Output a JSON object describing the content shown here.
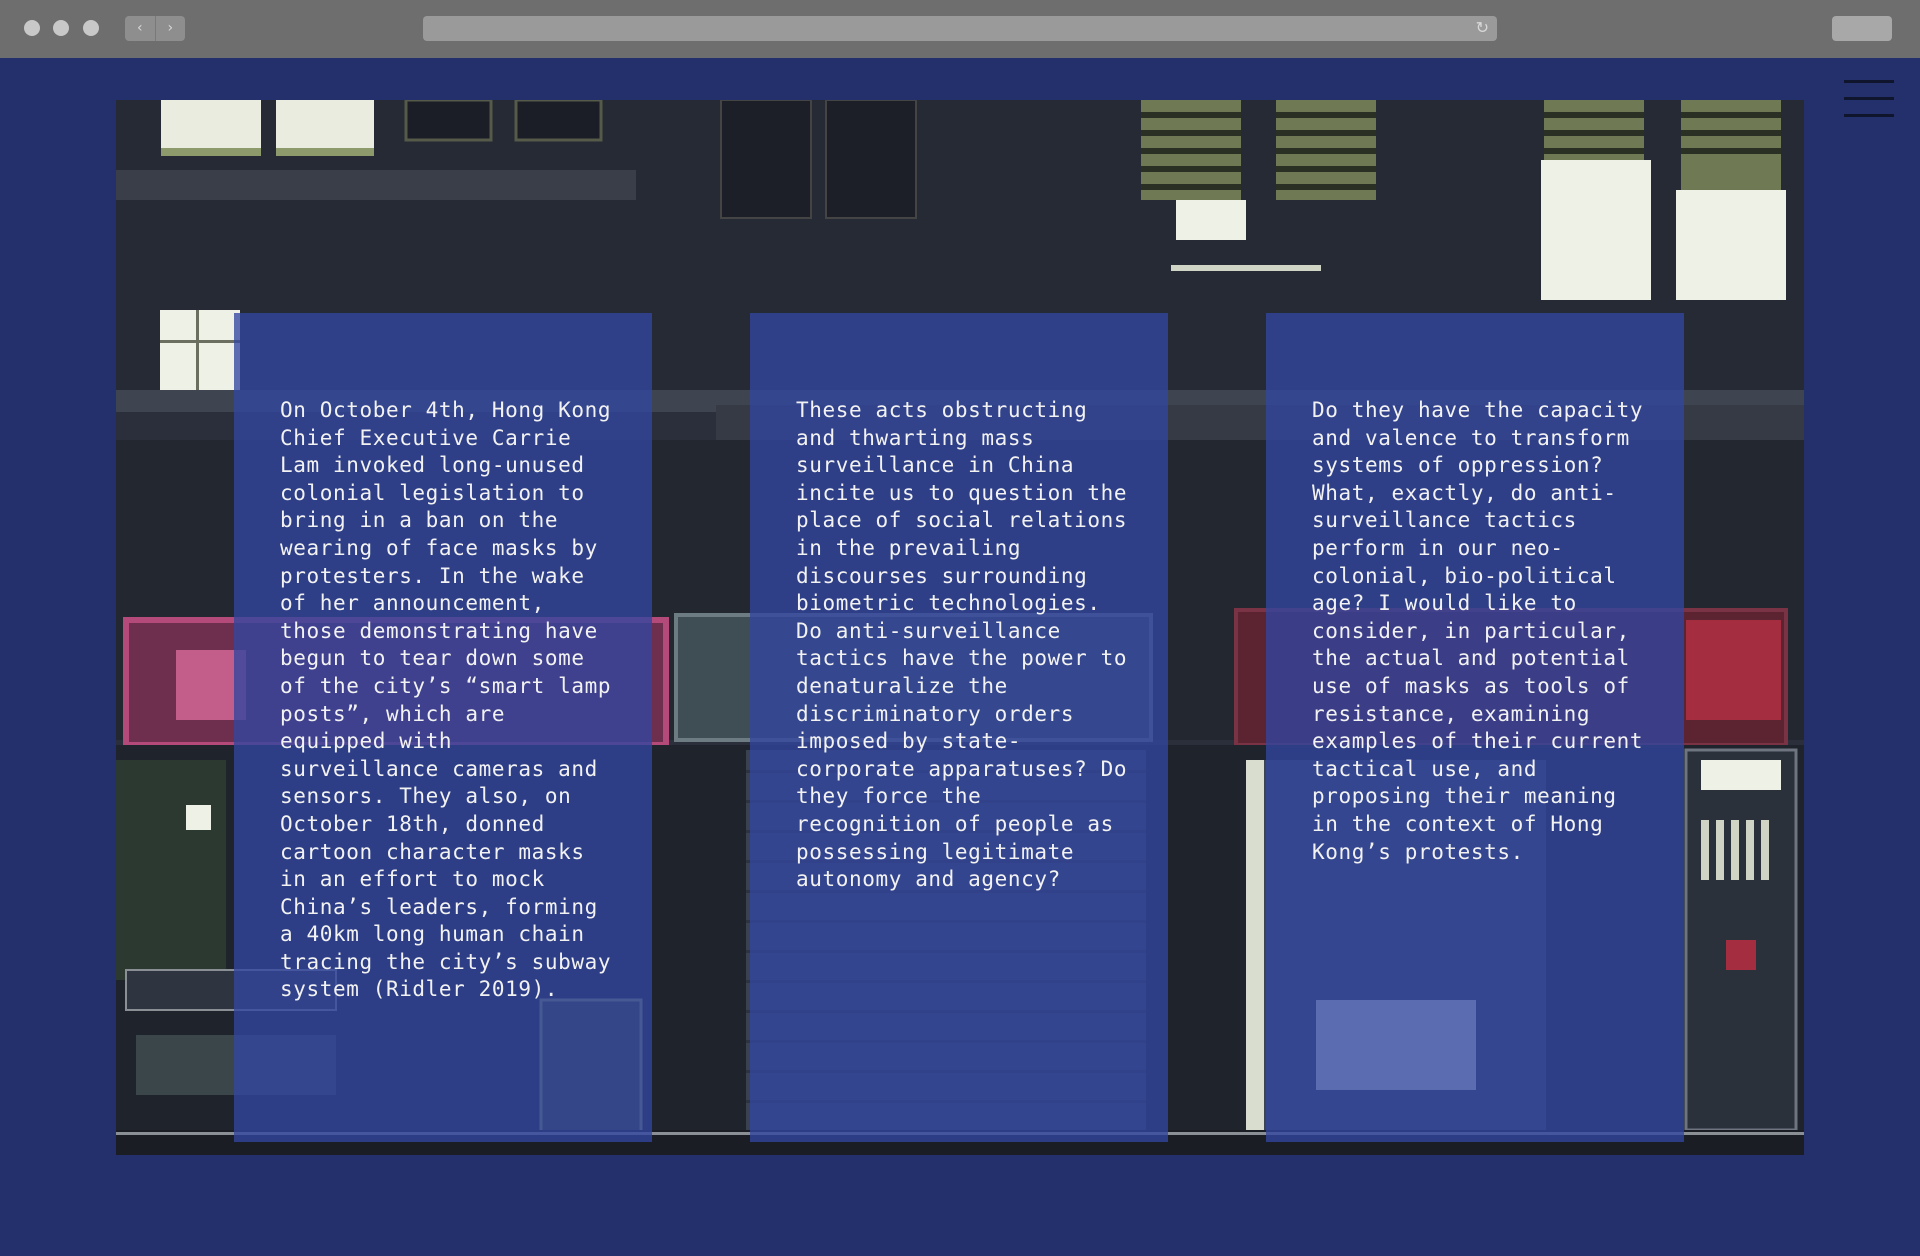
{
  "browser": {
    "back_icon": "chevron-left-icon",
    "forward_icon": "chevron-right-icon",
    "reload_icon": "reload-icon",
    "back_glyph": "‹",
    "forward_glyph": "›",
    "reload_glyph": "↻"
  },
  "menu": {
    "icon": "hamburger-menu-icon"
  },
  "colors": {
    "page_background": "#23306b",
    "panel_background": "rgba(50,70,160,0.78)",
    "text": "#f2f2f2",
    "chrome": "#6e6e6e"
  },
  "panels": [
    {
      "text": "On October 4th, Hong Kong Chief Executive Carrie Lam invoked long-unused colonial legislation to bring in a ban on the wearing of face masks by protesters. In the wake of her announcement, those demonstrating have begun to tear down some of the city’s “smart lamp posts”, which are equipped with surveillance cameras and sensors. They also, on October 18th, donned cartoon character masks in an effort to mock China’s leaders, forming a 40km long human chain tracing the city’s subway system (Ridler 2019)."
    },
    {
      "text": "These acts obstructing and thwarting mass surveillance in China incite us to question the place of social relations in the prevailing discourses surrounding biometric technologies. Do anti-surveillance tactics have the power to denaturalize the discriminatory orders imposed by state-corporate apparatuses? Do they force the recognition of people as possessing legitimate autonomy and agency?"
    },
    {
      "text": "Do they have the capacity and valence to transform systems of oppression? What, exactly, do anti-surveillance tactics perform in our neo-colonial, bio-political age? I would like to consider, in particular, the actual and potential use of masks as tools of resistance, examining examples of their current tactical use, and proposing their meaning in the context of Hong Kong’s protests."
    }
  ]
}
